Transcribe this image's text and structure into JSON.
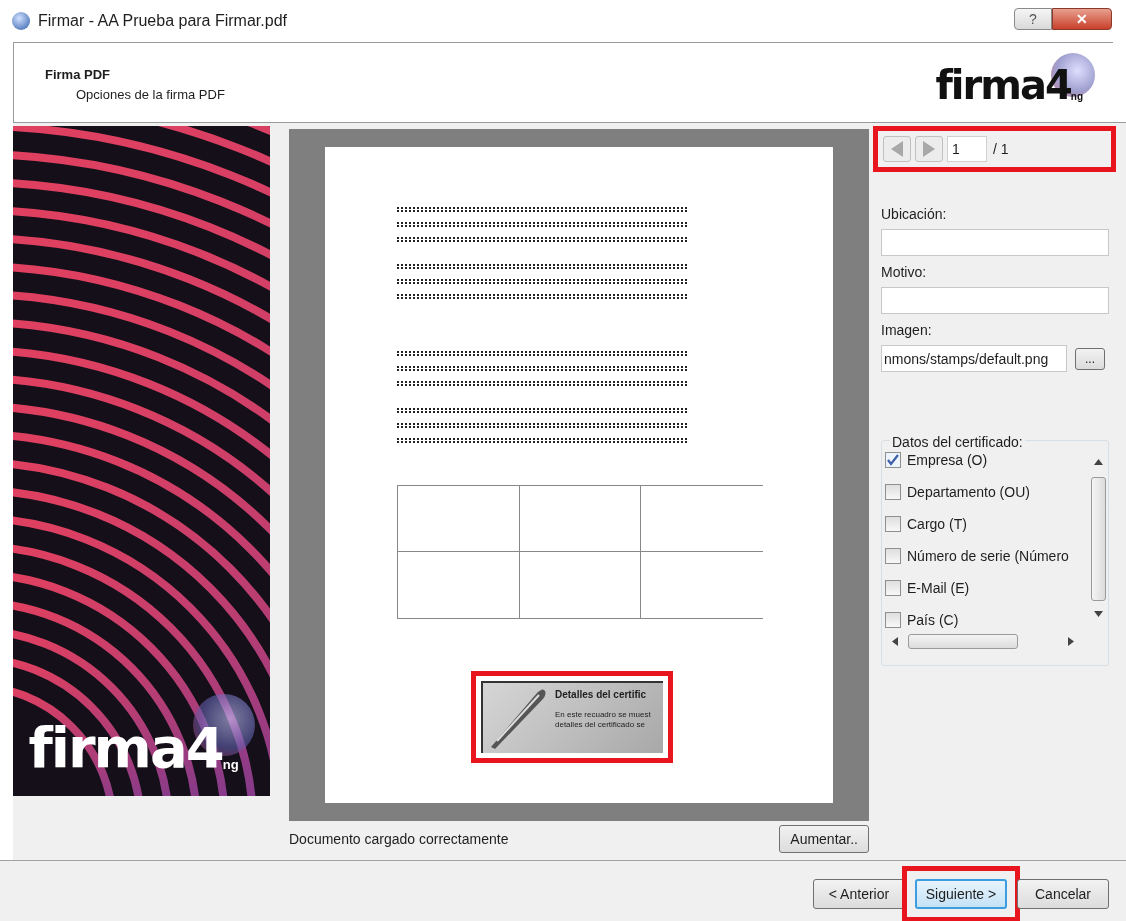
{
  "window": {
    "title": "Firmar - AA Prueba para Firmar.pdf",
    "controls": [
      "?",
      "✕"
    ]
  },
  "header": {
    "title": "Firma PDF",
    "subtitle": "Opciones de la firma PDF",
    "logo": {
      "main": "firma4",
      "suffix": "ng"
    }
  },
  "banner": {
    "logo": {
      "main": "firma4",
      "suffix": "ng"
    }
  },
  "preview": {
    "signature_stamp": {
      "title": "Detalles del certific",
      "lines": [
        "En este recuadro se muest",
        "detalles del certificado se"
      ],
      "highlighted": true
    }
  },
  "page_nav": {
    "page": "1",
    "total": "/ 1",
    "highlighted": true
  },
  "fields": [
    {
      "label": "Ubicación:"
    },
    {
      "label": "Motivo:"
    },
    {
      "label": "Imagen:",
      "value": "nmons/stamps/default.png",
      "browse": "..."
    }
  ],
  "certificate_data": {
    "legend": "Datos del certificado:",
    "items": [
      {
        "label": "Empresa (O)",
        "checked": true
      },
      {
        "label": "Departamento (OU)",
        "checked": false
      },
      {
        "label": "Cargo (T)",
        "checked": false
      },
      {
        "label": "Número de serie (Número",
        "checked": false
      },
      {
        "label": "E-Mail (E)",
        "checked": false
      },
      {
        "label": "País (C)",
        "checked": false
      }
    ]
  },
  "status": "Documento cargado correctamente",
  "zoom_button": "Aumentar..",
  "buttons": [
    {
      "label": "< Anterior",
      "default": false,
      "highlighted": false
    },
    {
      "label": "Siguiente >",
      "default": true,
      "highlighted": true
    },
    {
      "label": "Cancelar",
      "default": false,
      "highlighted": false
    }
  ]
}
